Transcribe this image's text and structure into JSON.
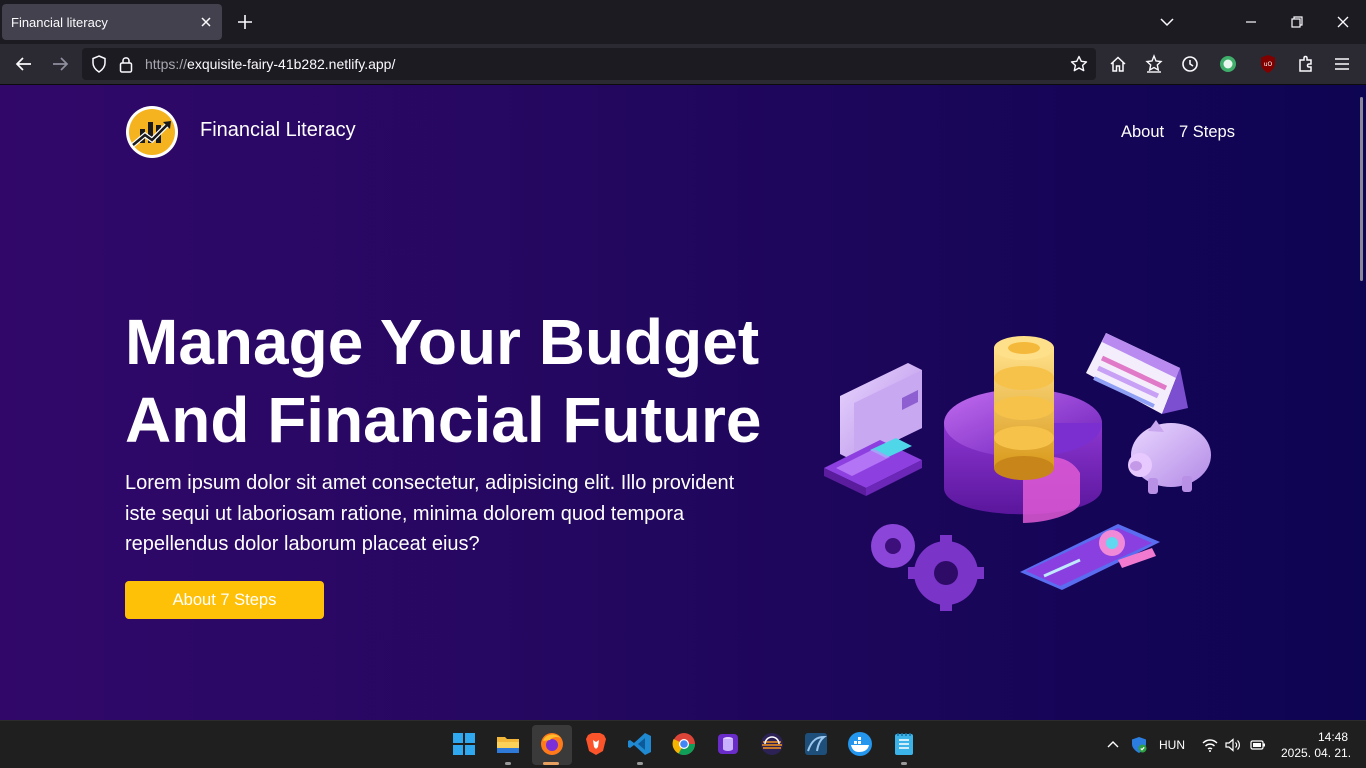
{
  "browser": {
    "tab_title": "Financial literacy",
    "url_host_prefix": "https://",
    "url_rest": "exquisite-fairy-41b282.netlify.app/"
  },
  "site": {
    "brand": "Financial Literacy",
    "nav": [
      "About",
      "7 Steps"
    ],
    "hero_title_line1": "Manage Your Budget",
    "hero_title_line2": "And Financial Future",
    "hero_text": "Lorem ipsum dolor sit amet consectetur, adipisicing elit. Illo provident iste sequi ut laboriosam ratione, minima dolorem quod tempora repellendus dolor laborum placeat eius?",
    "cta_label": "About 7 Steps",
    "accent_color": "#ffc107"
  },
  "taskbar": {
    "apps": [
      "windows-start-icon",
      "file-explorer-icon",
      "firefox-icon",
      "brave-icon",
      "vscode-icon",
      "chrome-icon",
      "database-icon",
      "eclipse-icon",
      "mysql-workbench-icon",
      "docker-icon",
      "notepad-icon"
    ],
    "language": "HUN",
    "time": "14:48",
    "date": "2025. 04. 21."
  }
}
